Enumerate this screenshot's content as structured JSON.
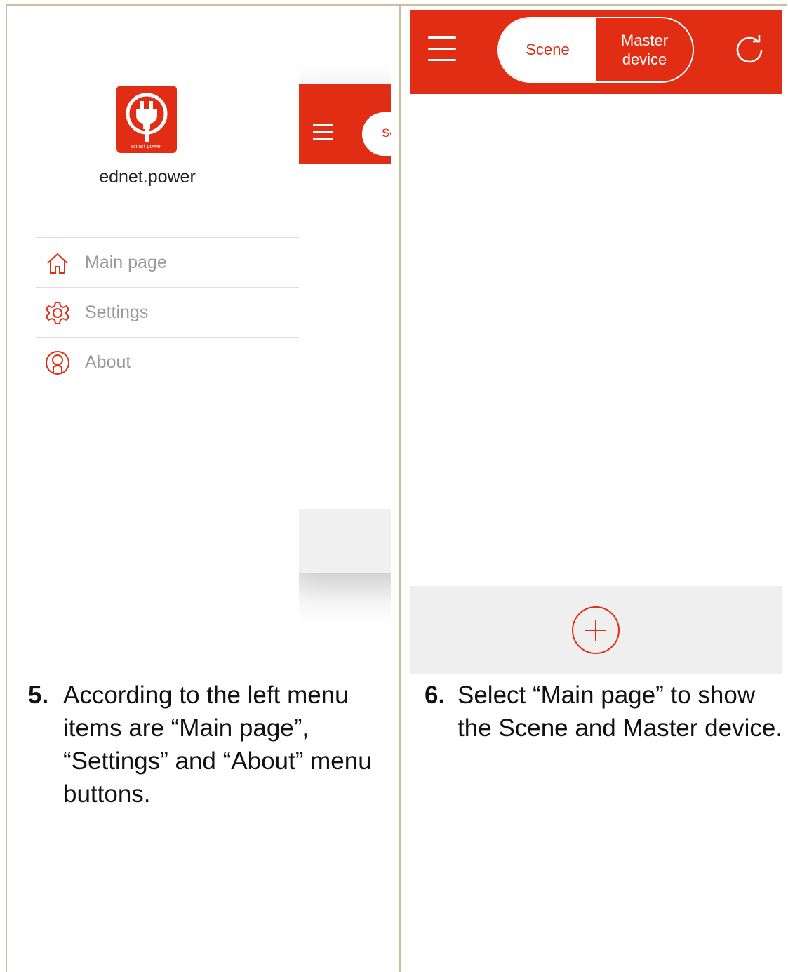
{
  "left_screen": {
    "logo_caption": "smart power",
    "app_name": "ednet.power",
    "behind_tab_label": "Sc",
    "menu_items": [
      {
        "label": "Main page",
        "icon": "home-icon"
      },
      {
        "label": "Settings",
        "icon": "gear-icon"
      },
      {
        "label": "About",
        "icon": "user-icon"
      }
    ]
  },
  "right_screen": {
    "tabs": {
      "scene": "Scene",
      "master_device": "Master\ndevice"
    },
    "icons": [
      "menu-icon",
      "refresh-icon",
      "plus-icon"
    ]
  },
  "captions": [
    {
      "number": "5.",
      "text": "According to the left menu items are “Main page”, “Settings” and “About” menu buttons."
    },
    {
      "number": "6.",
      "text": "Select “Main page” to show the Scene and Master device."
    }
  ],
  "colors": {
    "accent": "#e12d13",
    "footer_bg": "#efefef",
    "page_border": "#c9bf9e"
  }
}
